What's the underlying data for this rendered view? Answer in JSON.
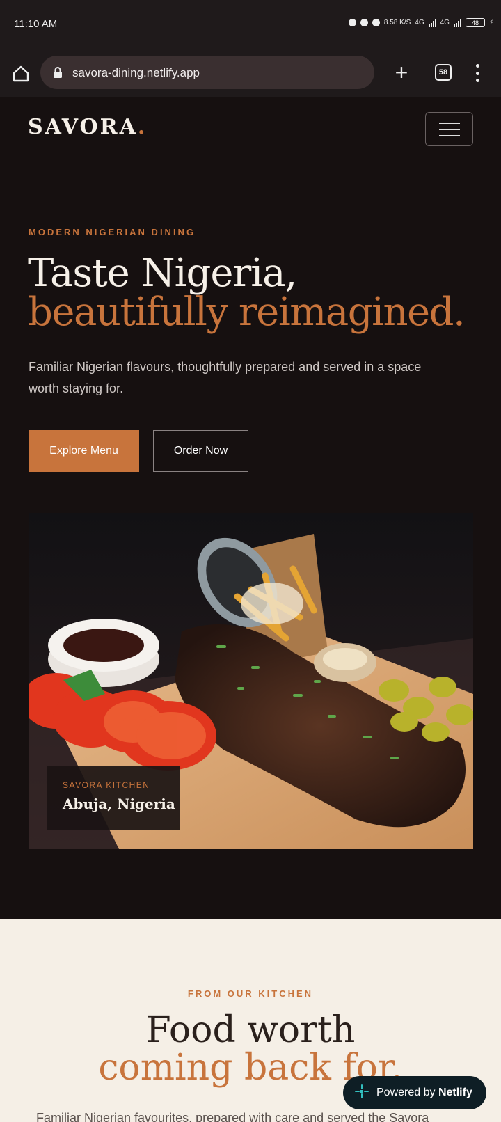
{
  "status_bar": {
    "time": "11:10 AM",
    "speed": "8.58 K/S",
    "network1": "4G",
    "network2": "4G",
    "battery": "48"
  },
  "browser": {
    "url": "savora-dining.netlify.app",
    "tab_count": "58",
    "icons": [
      "home-icon",
      "lock-icon",
      "plus-icon",
      "tabs-icon",
      "more-vert-icon"
    ]
  },
  "header": {
    "logo": "SAVORA",
    "logo_dot": ".",
    "menu_icon": "hamburger-icon"
  },
  "hero": {
    "eyebrow": "MODERN NIGERIAN DINING",
    "title_line1": "Taste Nigeria,",
    "title_line2": "beautifully reimagined.",
    "description": "Familiar Nigerian flavours, thoughtfully prepared and served in a space worth staying for.",
    "primary_button": "Explore Menu",
    "secondary_button": "Order Now",
    "image_location_label": "SAVORA KITCHEN",
    "image_location_name": "Abuja, Nigeria"
  },
  "kitchen": {
    "eyebrow": "FROM OUR KITCHEN",
    "title_line1": "Food worth",
    "title_line2": "coming back for.",
    "description": "Familiar Nigerian favourites, prepared with care and served the Savora"
  },
  "badge": {
    "prefix": "Powered by",
    "brand": "Netlify"
  },
  "colors": {
    "accent": "#c8743c",
    "background": "#161010",
    "cream": "#f5efe6"
  }
}
